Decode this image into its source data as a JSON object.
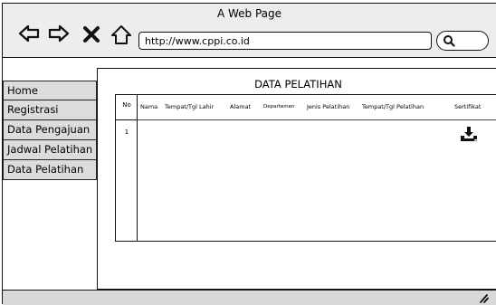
{
  "window": {
    "title": "A Web Page"
  },
  "address_bar": {
    "url": "http://www.cppi.co.id"
  },
  "sidebar": {
    "items": [
      {
        "label": "Home"
      },
      {
        "label": "Registrasi"
      },
      {
        "label": "Data Pengajuan"
      },
      {
        "label": "Jadwal Pelatihan"
      },
      {
        "label": "Data Pelatihan"
      }
    ]
  },
  "main": {
    "title": "DATA PELATIHAN",
    "table": {
      "headers": {
        "no": "No",
        "nama": "Nama",
        "ttl": "Tempat/Tgl Lahir",
        "alamat": "Alamat",
        "departemen": "Departemen",
        "jenis": "Jenis Pelatihan",
        "tempat_pelatihan": "Tempat/Tgl Pelatihan",
        "sertifikat": "Sertifikat"
      },
      "rows": [
        {
          "no": "1",
          "sertifikat_icon": "download-icon"
        }
      ]
    }
  }
}
